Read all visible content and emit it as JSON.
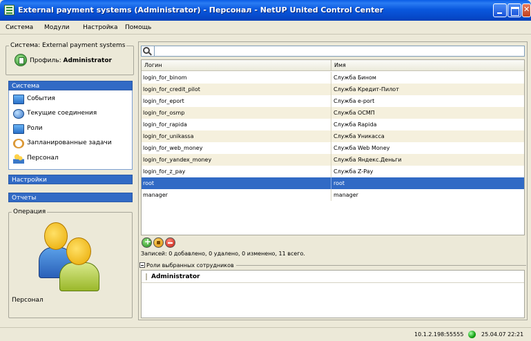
{
  "window": {
    "title": "External payment systems (Administrator) - Персонал - NetUP United Control Center"
  },
  "menu": [
    "Система",
    "Модули",
    "Настройка",
    "Помощь"
  ],
  "left": {
    "system_legend": "Система: External payment systems",
    "profile_label": "Профиль:",
    "profile_value": "Administrator",
    "sections": {
      "system": {
        "title": "Система",
        "items": [
          {
            "label": "События",
            "icon": "monitor-icon"
          },
          {
            "label": "Текущие соединения",
            "icon": "globe-icon"
          },
          {
            "label": "Роли",
            "icon": "monitor-icon"
          },
          {
            "label": "Запланированные задачи",
            "icon": "clock-icon"
          },
          {
            "label": "Персонал",
            "icon": "people-icon"
          }
        ]
      },
      "settings": {
        "title": "Настройки"
      },
      "reports": {
        "title": "Отчеты"
      }
    },
    "operation_legend": "Операция",
    "operation_label": "Персонал"
  },
  "table": {
    "columns": [
      "Логин",
      "Имя"
    ],
    "rows": [
      [
        "login_for_binom",
        "Служба Бином"
      ],
      [
        "login_for_credit_pilot",
        "Служба Кредит-Пилот"
      ],
      [
        "login_for_eport",
        "Служба e-port"
      ],
      [
        "login_for_osmp",
        "Служба ОСМП"
      ],
      [
        "login_for_rapida",
        "Служба Rapida"
      ],
      [
        "login_for_unikassa",
        "Служба Уникасса"
      ],
      [
        "login_for_web_money",
        "Служба Web Money"
      ],
      [
        "login_for_yandex_money",
        "Служба Яндекс.Деньги"
      ],
      [
        "login_for_z_pay",
        "Служба Z-Pay"
      ],
      [
        "root",
        "root"
      ],
      [
        "manager",
        "manager"
      ]
    ],
    "selected_row": 9
  },
  "records_text": "Записей: 0 добавлено, 0 удалено, 0 изменено, 11 всего.",
  "roles": {
    "legend": "Роли выбранных сотрудников",
    "items": [
      "Administrator"
    ]
  },
  "status": {
    "ip": "10.1.2.198:55555",
    "datetime": "25.04.07 22:21",
    "connection_color": "#12a012"
  },
  "colors": {
    "selection": "#316ac5",
    "alt_row": "#f5f0dd",
    "titlebar": "#0a58de"
  }
}
